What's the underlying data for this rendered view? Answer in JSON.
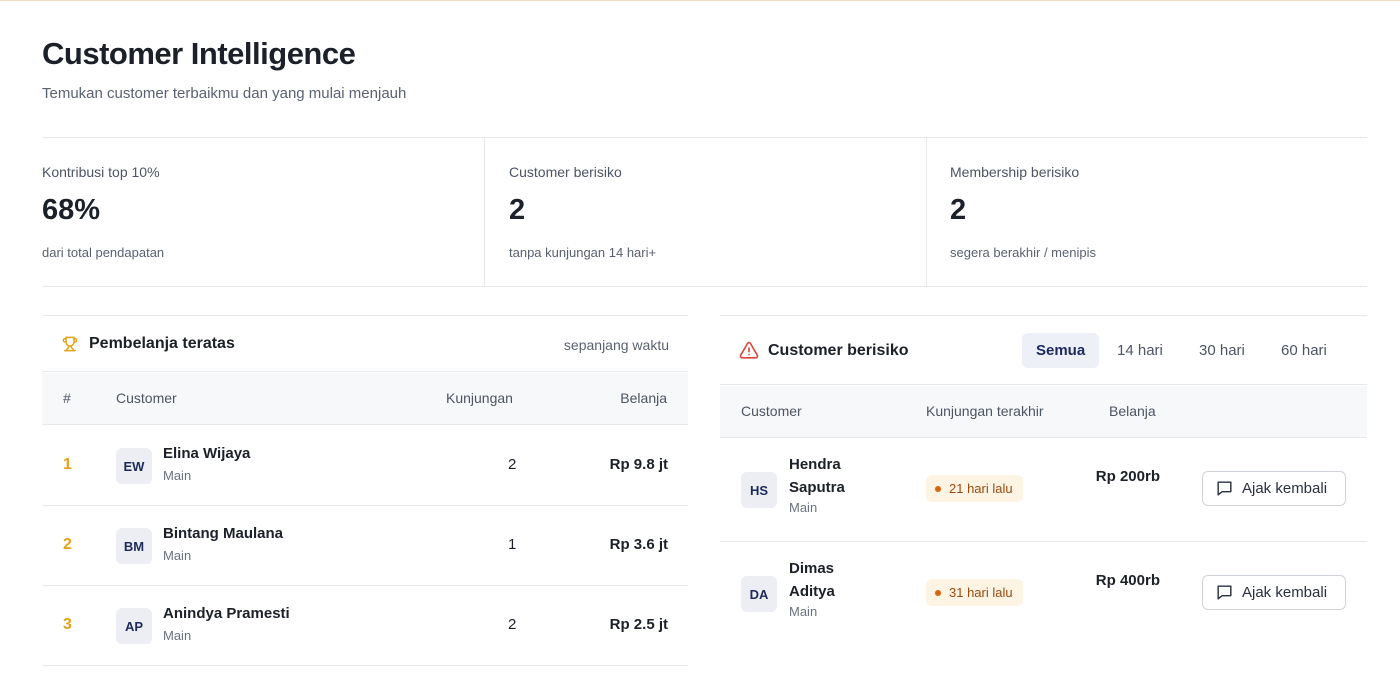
{
  "header": {
    "title": "Customer Intelligence",
    "subtitle": "Temukan customer terbaikmu dan yang mulai menjauh"
  },
  "stats": [
    {
      "label": "Kontribusi top 10%",
      "value": "68%",
      "sub": "dari total pendapatan"
    },
    {
      "label": "Customer berisiko",
      "value": "2",
      "sub": "tanpa kunjungan 14 hari+"
    },
    {
      "label": "Membership berisiko",
      "value": "2",
      "sub": "segera berakhir / menipis"
    }
  ],
  "top_spenders": {
    "title": "Pembelanja teratas",
    "period": "sepanjang waktu",
    "columns": {
      "rank": "#",
      "customer": "Customer",
      "visits": "Kunjungan",
      "spend": "Belanja"
    },
    "rows": [
      {
        "rank": "1",
        "initials": "EW",
        "name": "Elina Wijaya",
        "branch": "Main",
        "visits": "2",
        "spend": "Rp 9.8 jt"
      },
      {
        "rank": "2",
        "initials": "BM",
        "name": "Bintang Maulana",
        "branch": "Main",
        "visits": "1",
        "spend": "Rp 3.6 jt"
      },
      {
        "rank": "3",
        "initials": "AP",
        "name": "Anindya Pramesti",
        "branch": "Main",
        "visits": "2",
        "spend": "Rp 2.5 jt"
      }
    ]
  },
  "at_risk": {
    "title": "Customer berisiko",
    "tabs": [
      {
        "label": "Semua",
        "active": true
      },
      {
        "label": "14 hari",
        "active": false
      },
      {
        "label": "30 hari",
        "active": false
      },
      {
        "label": "60 hari",
        "active": false
      }
    ],
    "columns": {
      "customer": "Customer",
      "last_visit": "Kunjungan terakhir",
      "spend": "Belanja"
    },
    "rows": [
      {
        "initials": "HS",
        "name": "Hendra Saputra",
        "branch": "Main",
        "last_visit": "21 hari lalu",
        "spend": "Rp 200rb",
        "action": "Ajak kembali"
      },
      {
        "initials": "DA",
        "name": "Dimas Aditya",
        "branch": "Main",
        "last_visit": "31 hari lalu",
        "spend": "Rp 400rb",
        "action": "Ajak kembali"
      }
    ]
  },
  "colors": {
    "rank_accent": "#e0a31a",
    "warning_red": "#d9483b",
    "badge_bg": "#fdf4e3",
    "badge_text": "#9a4a12",
    "active_tab_bg": "#eef0f7"
  },
  "icons": {
    "top_spenders": "trophy-icon",
    "at_risk": "warning-triangle-icon",
    "action": "message-icon"
  }
}
